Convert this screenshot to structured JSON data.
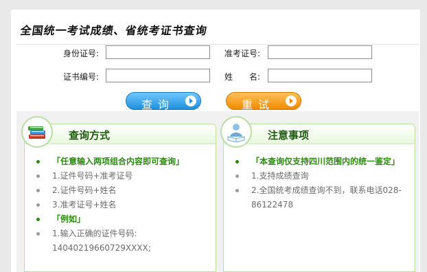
{
  "header": {
    "title": "全国统一考试成绩、省统考证书查询"
  },
  "form": {
    "id_label": "身份证号:",
    "exam_no_label": "准考证号:",
    "cert_no_label": "证书编号:",
    "name_label": "姓　　名:",
    "id_value": "",
    "exam_no_value": "",
    "cert_no_value": "",
    "name_value": ""
  },
  "buttons": {
    "query_label": "查询",
    "reset_label": "重试"
  },
  "panels": {
    "query_method": {
      "title": "查询方式",
      "items": [
        {
          "type": "head",
          "text": "「任意输入两项组合内容即可查询」"
        },
        {
          "type": "item",
          "text": "1.证件号码+准考证号"
        },
        {
          "type": "item",
          "text": "2.证件号码+姓名"
        },
        {
          "type": "item",
          "text": "3.准考证号+姓名"
        },
        {
          "type": "head",
          "text": "「例如」"
        },
        {
          "type": "item",
          "text": "1.输入正确的证件号码: 14040219660729XXXX;"
        }
      ]
    },
    "notice": {
      "title": "注意事项",
      "items": [
        {
          "type": "head",
          "text": "「本查询仅支持四川范围内的统一鉴定」"
        },
        {
          "type": "item",
          "text": "1.支持成绩查询"
        },
        {
          "type": "item",
          "text": "2.全国统考成绩查询不到，联系电话028-86122478"
        }
      ]
    }
  },
  "colors": {
    "query_button": "#1f8fdb",
    "reset_button": "#f08a00",
    "panel_heading": "#2b8a0f"
  },
  "icons": {
    "query_method": "books-icon",
    "notice": "reading-person-icon",
    "button_arrow": "play-arrow-icon"
  }
}
